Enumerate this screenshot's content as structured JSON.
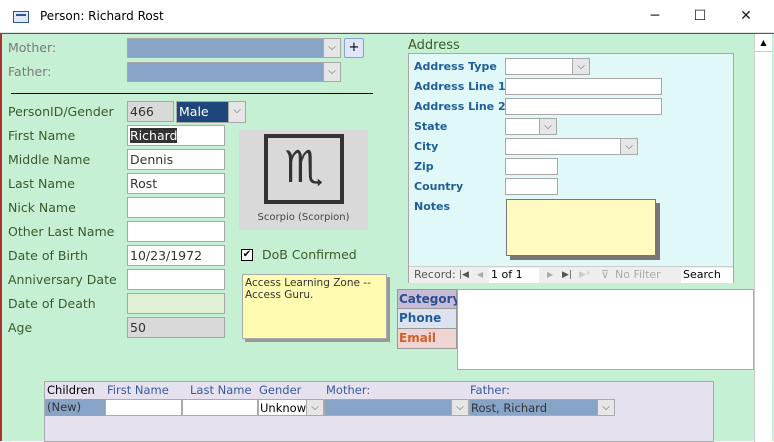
{
  "window": {
    "title": "Person: Richard Rost",
    "minimize": "─",
    "maximize": "☐",
    "close": "✕"
  },
  "parents": {
    "mother_label": "Mother:",
    "father_label": "Father:",
    "add_button": "+"
  },
  "person": {
    "id_gender_label": "PersonID/Gender",
    "person_id": "466",
    "gender": "Male",
    "first_name_label": "First Name",
    "first_name": "Richard",
    "middle_name_label": "Middle Name",
    "middle_name": "Dennis",
    "last_name_label": "Last Name",
    "last_name": "Rost",
    "nick_name_label": "Nick Name",
    "nick_name": "",
    "other_last_name_label": "Other Last Name",
    "other_last_name": "",
    "dob_label": "Date of Birth",
    "dob": "10/23/1972",
    "anniversary_label": "Anniversary Date",
    "anniversary": "",
    "dod_label": "Date of Death",
    "dod": "",
    "age_label": "Age",
    "age": "50",
    "zodiac_caption": "Scorpio (Scorpion)",
    "zodiac_symbol": "♏",
    "dob_confirmed_label": "DoB Confirmed",
    "dob_confirmed": true,
    "notes": "Access Learning Zone -- Access Guru."
  },
  "address": {
    "heading": "Address",
    "type_label": "Address Type",
    "line1_label": "Address Line 1",
    "line2_label": "Address Line 2",
    "state_label": "State",
    "city_label": "City",
    "zip_label": "Zip",
    "country_label": "Country",
    "notes_label": "Notes",
    "nav": {
      "record_label": "Record:",
      "position": "1 of 1",
      "filter": "No Filter",
      "search": "Search"
    }
  },
  "contact_tabs": [
    {
      "label": "Category",
      "color": "#2a4f8f"
    },
    {
      "label": "Phone",
      "color": "#1f5e9a"
    },
    {
      "label": "Email",
      "color": "#d0602a"
    }
  ],
  "children": {
    "headers": [
      "Children",
      "First Name",
      "Last Name",
      "Gender",
      "Mother:",
      "Father:"
    ],
    "rows": [
      {
        "record": "(New)",
        "first": "",
        "last": "",
        "gender": "Unknown",
        "mother": "",
        "father": "Rost, Richard"
      }
    ]
  }
}
